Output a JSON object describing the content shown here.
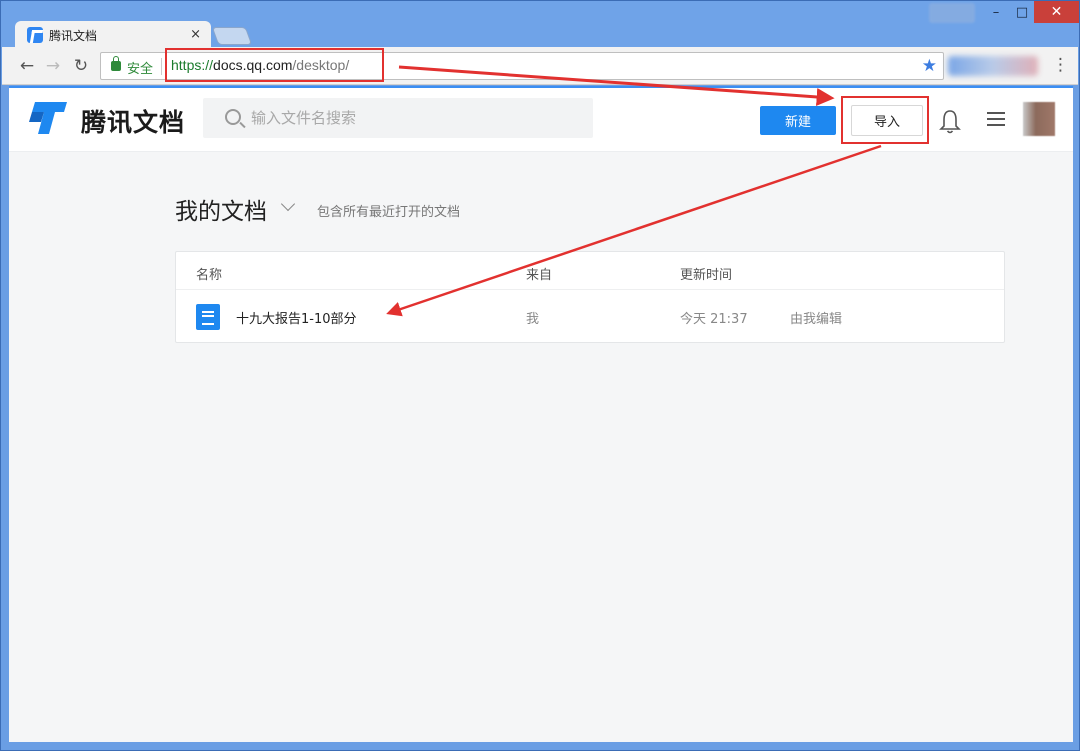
{
  "browser": {
    "tab_title": "腾讯文档",
    "tab_close": "×",
    "secure_label": "安全",
    "url_scheme": "https://",
    "url_host": "docs.qq.com",
    "url_path": "/desktop/",
    "window_controls": {
      "minimize": "–",
      "maximize": "□",
      "close": "✕"
    }
  },
  "header": {
    "logo_text": "腾讯文档",
    "search_placeholder": "输入文件名搜索",
    "new_button": "新建",
    "import_button": "导入"
  },
  "main": {
    "title": "我的文档",
    "subtitle": "包含所有最近打开的文档",
    "columns": {
      "name": "名称",
      "from": "来自",
      "updated": "更新时间"
    },
    "rows": [
      {
        "name": "十九大报告1-10部分",
        "from": "我",
        "time": "今天 21:37",
        "edited_by": "由我编辑"
      }
    ]
  },
  "colors": {
    "accent": "#1e88f0",
    "annotation": "#e2312f"
  }
}
